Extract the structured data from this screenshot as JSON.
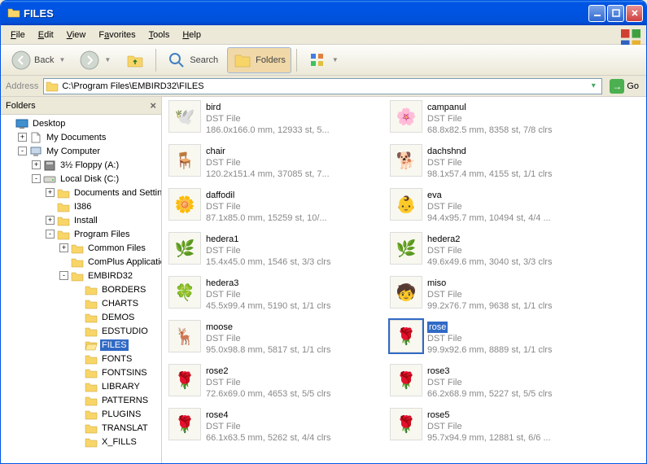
{
  "title": "FILES",
  "menubar": [
    "File",
    "Edit",
    "View",
    "Favorites",
    "Tools",
    "Help"
  ],
  "toolbar": {
    "back": "Back",
    "search": "Search",
    "folders": "Folders"
  },
  "addressbar": {
    "label": "Address",
    "value": "C:\\Program Files\\EMBIRD32\\FILES",
    "go": "Go"
  },
  "tree_panel_label": "Folders",
  "tree": [
    {
      "indent": 0,
      "toggle": null,
      "icon": "desktop",
      "label": "Desktop"
    },
    {
      "indent": 1,
      "toggle": "+",
      "icon": "mydocs",
      "label": "My Documents"
    },
    {
      "indent": 1,
      "toggle": "-",
      "icon": "mycomp",
      "label": "My Computer"
    },
    {
      "indent": 2,
      "toggle": "+",
      "icon": "floppy",
      "label": "3½ Floppy (A:)"
    },
    {
      "indent": 2,
      "toggle": "-",
      "icon": "drive",
      "label": "Local Disk (C:)"
    },
    {
      "indent": 3,
      "toggle": "+",
      "icon": "folder",
      "label": "Documents and Settings"
    },
    {
      "indent": 3,
      "toggle": null,
      "icon": "folder",
      "label": "I386"
    },
    {
      "indent": 3,
      "toggle": "+",
      "icon": "folder",
      "label": "Install"
    },
    {
      "indent": 3,
      "toggle": "-",
      "icon": "folder",
      "label": "Program Files"
    },
    {
      "indent": 4,
      "toggle": "+",
      "icon": "folder",
      "label": "Common Files"
    },
    {
      "indent": 4,
      "toggle": null,
      "icon": "folder",
      "label": "ComPlus Applications"
    },
    {
      "indent": 4,
      "toggle": "-",
      "icon": "folder",
      "label": "EMBIRD32"
    },
    {
      "indent": 5,
      "toggle": null,
      "icon": "folder",
      "label": "BORDERS"
    },
    {
      "indent": 5,
      "toggle": null,
      "icon": "folder",
      "label": "CHARTS"
    },
    {
      "indent": 5,
      "toggle": null,
      "icon": "folder",
      "label": "DEMOS"
    },
    {
      "indent": 5,
      "toggle": null,
      "icon": "folder",
      "label": "EDSTUDIO"
    },
    {
      "indent": 5,
      "toggle": null,
      "icon": "folder-open",
      "label": "FILES",
      "selected": true
    },
    {
      "indent": 5,
      "toggle": null,
      "icon": "folder",
      "label": "FONTS"
    },
    {
      "indent": 5,
      "toggle": null,
      "icon": "folder",
      "label": "FONTSINS"
    },
    {
      "indent": 5,
      "toggle": null,
      "icon": "folder",
      "label": "LIBRARY"
    },
    {
      "indent": 5,
      "toggle": null,
      "icon": "folder",
      "label": "PATTERNS"
    },
    {
      "indent": 5,
      "toggle": null,
      "icon": "folder",
      "label": "PLUGINS"
    },
    {
      "indent": 5,
      "toggle": null,
      "icon": "folder",
      "label": "TRANSLAT"
    },
    {
      "indent": 5,
      "toggle": null,
      "icon": "folder",
      "label": "X_FILLS"
    }
  ],
  "files": [
    {
      "name": "bird",
      "type": "DST File",
      "stats": "186.0x166.0 mm, 12933 st, 5...",
      "thumb": "🕊️"
    },
    {
      "name": "campanul",
      "type": "DST File",
      "stats": "68.8x82.5 mm, 8358 st, 7/8 clrs",
      "thumb": "🌸"
    },
    {
      "name": "chair",
      "type": "DST File",
      "stats": "120.2x151.4 mm, 37085 st, 7...",
      "thumb": "🪑"
    },
    {
      "name": "dachshnd",
      "type": "DST File",
      "stats": "98.1x57.4 mm, 4155 st, 1/1 clrs",
      "thumb": "🐕"
    },
    {
      "name": "daffodil",
      "type": "DST File",
      "stats": "87.1x85.0 mm, 15259 st, 10/...",
      "thumb": "🌼"
    },
    {
      "name": "eva",
      "type": "DST File",
      "stats": "94.4x95.7 mm, 10494 st, 4/4 ...",
      "thumb": "👶"
    },
    {
      "name": "hedera1",
      "type": "DST File",
      "stats": "15.4x45.0 mm, 1546 st, 3/3 clrs",
      "thumb": "🌿"
    },
    {
      "name": "hedera2",
      "type": "DST File",
      "stats": "49.6x49.6 mm, 3040 st, 3/3 clrs",
      "thumb": "🌿"
    },
    {
      "name": "hedera3",
      "type": "DST File",
      "stats": "45.5x99.4 mm, 5190 st, 1/1 clrs",
      "thumb": "🍀"
    },
    {
      "name": "miso",
      "type": "DST File",
      "stats": "99.2x76.7 mm, 9638 st, 1/1 clrs",
      "thumb": "🧒"
    },
    {
      "name": "moose",
      "type": "DST File",
      "stats": "95.0x98.8 mm, 5817 st, 1/1 clrs",
      "thumb": "🦌"
    },
    {
      "name": "rose",
      "type": "DST File",
      "stats": "99.9x92.6 mm, 8889 st, 1/1 clrs",
      "thumb": "🌹",
      "selected": true
    },
    {
      "name": "rose2",
      "type": "DST File",
      "stats": "72.6x69.0 mm, 4653 st, 5/5 clrs",
      "thumb": "🌹"
    },
    {
      "name": "rose3",
      "type": "DST File",
      "stats": "66.2x68.9 mm, 5227 st, 5/5 clrs",
      "thumb": "🌹"
    },
    {
      "name": "rose4",
      "type": "DST File",
      "stats": "66.1x63.5 mm, 5262 st, 4/4 clrs",
      "thumb": "🌹"
    },
    {
      "name": "rose5",
      "type": "DST File",
      "stats": "95.7x94.9 mm, 12881 st, 6/6 ...",
      "thumb": "🌹"
    }
  ]
}
